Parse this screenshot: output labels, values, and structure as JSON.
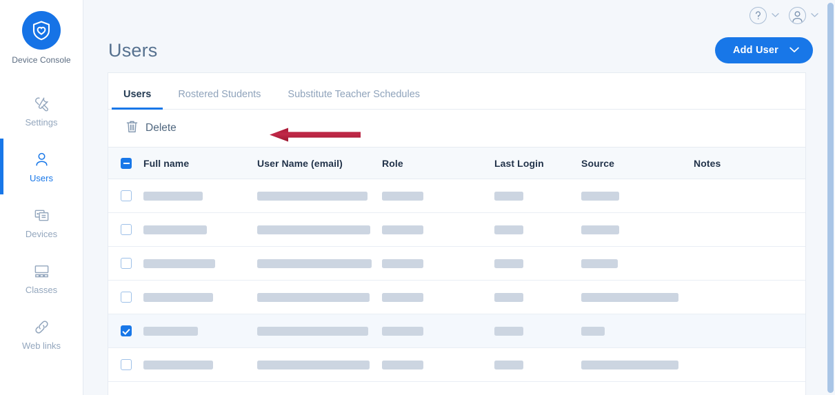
{
  "sidebar": {
    "brand": {
      "name": "Device Console",
      "logo_icon": "shield-heart-icon",
      "logo_color": "#1673e6"
    },
    "items": [
      {
        "label": "Settings",
        "icon": "tools-icon",
        "active": false
      },
      {
        "label": "Users",
        "icon": "person-icon",
        "active": true
      },
      {
        "label": "Devices",
        "icon": "devices-icon",
        "active": false
      },
      {
        "label": "Classes",
        "icon": "classes-icon",
        "active": false
      },
      {
        "label": "Web links",
        "icon": "link-icon",
        "active": false
      }
    ],
    "active_color": "#1877e8",
    "inactive_color": "#93a6bd"
  },
  "topbar": {
    "help": {
      "glyph": "?",
      "icon": "help-circle-icon"
    },
    "help_chevron": "chevron-down-icon",
    "account": {
      "glyph": "person",
      "icon": "account-avatar-icon"
    },
    "account_chevron": "chevron-down-icon"
  },
  "header": {
    "title": "Users",
    "add_user_label": "Add User",
    "add_user_chevron": "chevron-down-icon",
    "accent_color": "#1877e8"
  },
  "tabs": [
    {
      "label": "Users",
      "active": true
    },
    {
      "label": "Rostered Students",
      "active": false
    },
    {
      "label": "Substitute Teacher Schedules",
      "active": false
    }
  ],
  "toolbar": {
    "delete_label": "Delete",
    "delete_icon": "trash-icon"
  },
  "annotation": {
    "arrow_color": "#b01c3a",
    "arrow_direction": "left",
    "points_at": "Delete"
  },
  "table": {
    "select_all_state": "indeterminate",
    "columns": [
      "Full name",
      "User Name (email)",
      "Role",
      "Last Login",
      "Source",
      "Notes"
    ],
    "rows": [
      {
        "checked": false,
        "selected": false,
        "skeletons": {
          "name": 86,
          "email": 160,
          "role": 60,
          "login": 42,
          "source": 55,
          "notes": 0
        }
      },
      {
        "checked": false,
        "selected": false,
        "skeletons": {
          "name": 92,
          "email": 164,
          "role": 60,
          "login": 42,
          "source": 55,
          "notes": 0
        }
      },
      {
        "checked": false,
        "selected": false,
        "skeletons": {
          "name": 104,
          "email": 166,
          "role": 60,
          "login": 42,
          "source": 53,
          "notes": 0
        }
      },
      {
        "checked": false,
        "selected": false,
        "skeletons": {
          "name": 101,
          "email": 163,
          "role": 60,
          "login": 42,
          "source": 141,
          "notes": 0
        }
      },
      {
        "checked": true,
        "selected": true,
        "skeletons": {
          "name": 79,
          "email": 161,
          "role": 60,
          "login": 42,
          "source": 34,
          "notes": 0
        }
      },
      {
        "checked": false,
        "selected": false,
        "skeletons": {
          "name": 101,
          "email": 163,
          "role": 60,
          "login": 42,
          "source": 141,
          "notes": 0
        }
      }
    ],
    "skeleton_color": "#ccd5e1",
    "selected_row_bg": "#f4f8fd"
  },
  "scrollbar": {
    "thumb_color": "#a9c5e6"
  }
}
